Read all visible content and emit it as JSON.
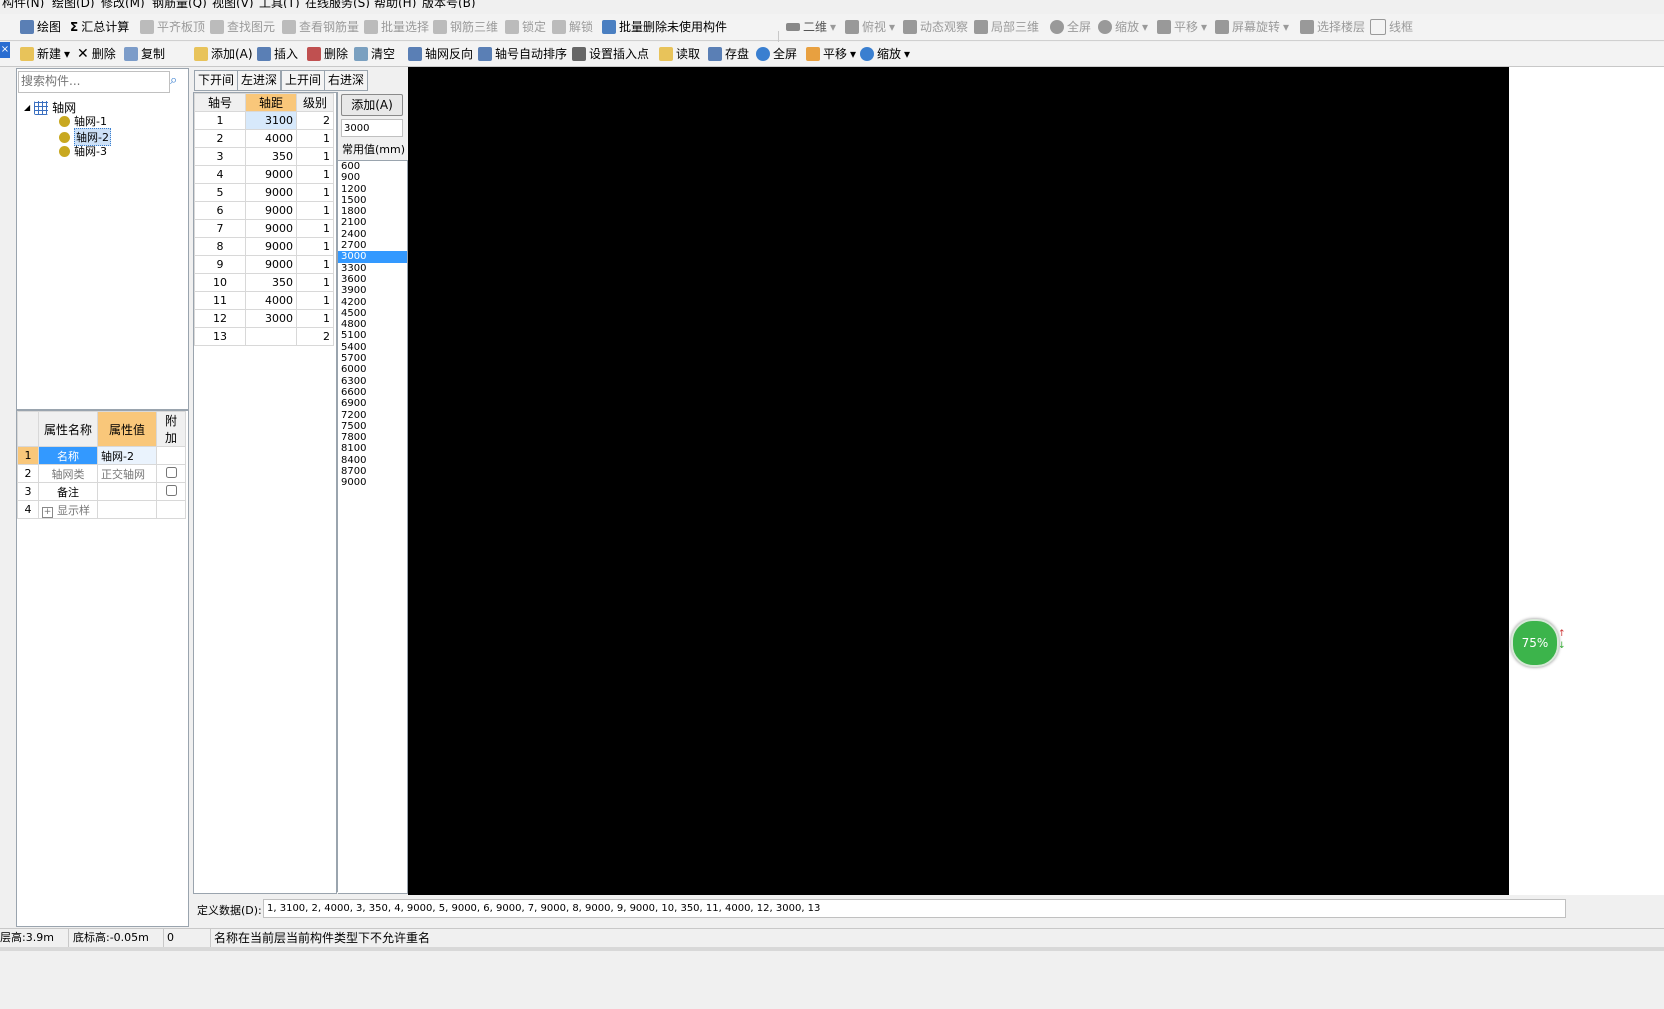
{
  "menu": [
    "构件(N)",
    "绘图(D)",
    "修改(M)",
    "钢筋量(Q)",
    "视图(V)",
    "工具(T)",
    "在线服务(S)",
    "帮助(H)",
    "版本号(B)"
  ],
  "toolbar1": {
    "draw": "绘图",
    "sum": "汇总计算",
    "flush_slab": "平齐板顶",
    "find": "查找图元",
    "view_rebar": "查看钢筋量",
    "batch_select": "批量选择",
    "rebar_3d": "钢筋三维",
    "lock": "锁定",
    "unlock": "解锁",
    "batch_delete": "批量删除未使用构件",
    "view2d": "二维",
    "top_view": "俯视",
    "dyn_view": "动态观察",
    "local_3d": "局部三维",
    "fullscreen": "全屏",
    "zoom": "缩放",
    "pan": "平移",
    "rotate": "屏幕旋转",
    "select_floor": "选择楼层",
    "wireframe": "线框"
  },
  "toolbar2": {
    "new": "新建",
    "delete": "删除",
    "copy": "复制",
    "add": "添加(A)",
    "insert": "插入",
    "delete2": "删除",
    "clear": "清空",
    "reverse": "轴网反向",
    "auto_sort": "轴号自动排序",
    "set_insert": "设置插入点",
    "read": "读取",
    "save": "存盘",
    "fullscreen": "全屏",
    "pan": "平移",
    "zoom": "缩放"
  },
  "search": {
    "placeholder": "搜索构件..."
  },
  "tree": {
    "root": "轴网",
    "children": [
      "轴网-1",
      "轴网-2",
      "轴网-3"
    ]
  },
  "properties": {
    "headers": [
      "属性名称",
      "属性值",
      "附加"
    ],
    "rows": [
      {
        "idx": "1",
        "name": "名称",
        "value": "轴网-2"
      },
      {
        "idx": "2",
        "name": "轴网类",
        "value": "正交轴网"
      },
      {
        "idx": "3",
        "name": "备注",
        "value": ""
      },
      {
        "idx": "4",
        "name": "显示样",
        "value": ""
      }
    ]
  },
  "tabs": [
    "下开间",
    "左进深",
    "上开间",
    "右进深"
  ],
  "axis_table": {
    "headers": [
      "轴号",
      "轴距",
      "级别"
    ],
    "rows": [
      [
        "1",
        "3100",
        "2"
      ],
      [
        "2",
        "4000",
        "1"
      ],
      [
        "3",
        "350",
        "1"
      ],
      [
        "4",
        "9000",
        "1"
      ],
      [
        "5",
        "9000",
        "1"
      ],
      [
        "6",
        "9000",
        "1"
      ],
      [
        "7",
        "9000",
        "1"
      ],
      [
        "8",
        "9000",
        "1"
      ],
      [
        "9",
        "9000",
        "1"
      ],
      [
        "10",
        "350",
        "1"
      ],
      [
        "11",
        "4000",
        "1"
      ],
      [
        "12",
        "3000",
        "1"
      ],
      [
        "13",
        "",
        "2"
      ]
    ]
  },
  "add_panel": {
    "button": "添加(A)",
    "value": "3000",
    "common_label": "常用值(mm)",
    "values": [
      "600",
      "900",
      "1200",
      "1500",
      "1800",
      "2100",
      "2400",
      "2700",
      "3000",
      "3300",
      "3600",
      "3900",
      "4200",
      "4500",
      "4800",
      "5100",
      "5400",
      "5700",
      "6000",
      "6300",
      "6600",
      "6900",
      "7200",
      "7500",
      "7800",
      "8100",
      "8400",
      "8700",
      "9000"
    ],
    "selected": "3000"
  },
  "define": {
    "label": "定义数据(D):",
    "value": "1, 3100, 2, 4000, 3, 350, 4, 9000, 5, 9000, 6, 9000, 7, 9000, 8, 9000, 9, 9000, 10, 350, 11, 4000, 12, 3000, 13"
  },
  "status": {
    "floor_height": "层高:3.9m",
    "bottom_elev": "底标高:-0.05m",
    "count": "0",
    "message": "名称在当前层当前构件类型下不允许重名"
  },
  "progress": {
    "label": "75%",
    "value": 75
  },
  "colors": {
    "canvas": "#000000",
    "selected_row": "#3399ff",
    "header_highlight": "#f9c77a",
    "progress": "#3cb44b"
  }
}
